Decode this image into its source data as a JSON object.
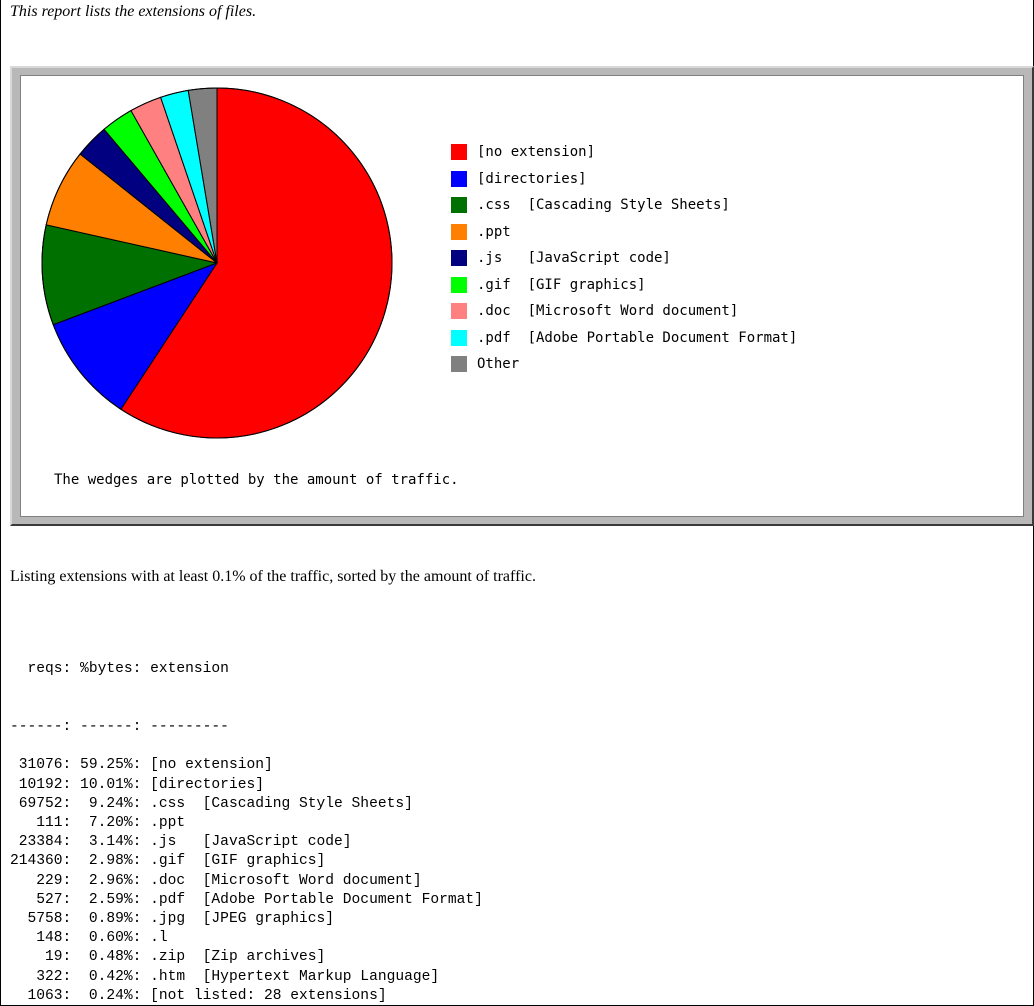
{
  "intro_text": "This report lists the extensions of files.",
  "chart_data": {
    "type": "pie",
    "title": "",
    "caption": "The wedges are plotted by the amount of traffic.",
    "slices": [
      {
        "label": ".css  [Cascading Style Sheets]",
        "value": 9.24,
        "color": "#007000"
      },
      {
        "label": ".ppt",
        "value": 7.2,
        "color": "#ff8000"
      },
      {
        "label": ".js   [JavaScript code]",
        "value": 3.14,
        "color": "#000080"
      },
      {
        "label": ".gif  [GIF graphics]",
        "value": 2.98,
        "color": "#00ff00"
      },
      {
        "label": ".doc  [Microsoft Word document]",
        "value": 2.96,
        "color": "#ff8080"
      },
      {
        "label": ".pdf  [Adobe Portable Document Format]",
        "value": 2.59,
        "color": "#00ffff"
      },
      {
        "label": "Other",
        "value": 2.63,
        "color": "#808080"
      },
      {
        "label": "[no extension]",
        "value": 59.25,
        "color": "#ff0000"
      },
      {
        "label": "[directories]",
        "value": 10.01,
        "color": "#0000ff"
      }
    ],
    "legend_entries": [
      {
        "label": "[no extension]",
        "color": "#ff0000"
      },
      {
        "label": "[directories]",
        "color": "#0000ff"
      },
      {
        "label": ".css  [Cascading Style Sheets]",
        "color": "#007000"
      },
      {
        "label": ".ppt",
        "color": "#ff8000"
      },
      {
        "label": ".js   [JavaScript code]",
        "color": "#000080"
      },
      {
        "label": ".gif  [GIF graphics]",
        "color": "#00ff00"
      },
      {
        "label": ".doc  [Microsoft Word document]",
        "color": "#ff8080"
      },
      {
        "label": ".pdf  [Adobe Portable Document Format]",
        "color": "#00ffff"
      },
      {
        "label": "Other",
        "color": "#808080"
      }
    ],
    "legend_position": "right"
  },
  "listing": {
    "intro": "Listing extensions with at least 0.1% of the traffic, sorted by the amount of traffic.",
    "header": "  reqs: %bytes: extension",
    "separator": "------: ------: ---------",
    "rows": [
      {
        "reqs": "31076",
        "bytes": "59.25%",
        "extension": "[no extension]"
      },
      {
        "reqs": "10192",
        "bytes": "10.01%",
        "extension": "[directories]"
      },
      {
        "reqs": "69752",
        "bytes": "9.24%",
        "extension": ".css  [Cascading Style Sheets]"
      },
      {
        "reqs": "111",
        "bytes": "7.20%",
        "extension": ".ppt"
      },
      {
        "reqs": "23384",
        "bytes": "3.14%",
        "extension": ".js   [JavaScript code]"
      },
      {
        "reqs": "214360",
        "bytes": "2.98%",
        "extension": ".gif  [GIF graphics]"
      },
      {
        "reqs": "229",
        "bytes": "2.96%",
        "extension": ".doc  [Microsoft Word document]"
      },
      {
        "reqs": "527",
        "bytes": "2.59%",
        "extension": ".pdf  [Adobe Portable Document Format]"
      },
      {
        "reqs": "5758",
        "bytes": "0.89%",
        "extension": ".jpg  [JPEG graphics]"
      },
      {
        "reqs": "148",
        "bytes": "0.60%",
        "extension": ".l"
      },
      {
        "reqs": "19",
        "bytes": "0.48%",
        "extension": ".zip  [Zip archives]"
      },
      {
        "reqs": "322",
        "bytes": "0.42%",
        "extension": ".htm  [Hypertext Markup Language]"
      },
      {
        "reqs": "1063",
        "bytes": "0.24%",
        "extension": "[not listed: 28 extensions]"
      }
    ]
  }
}
